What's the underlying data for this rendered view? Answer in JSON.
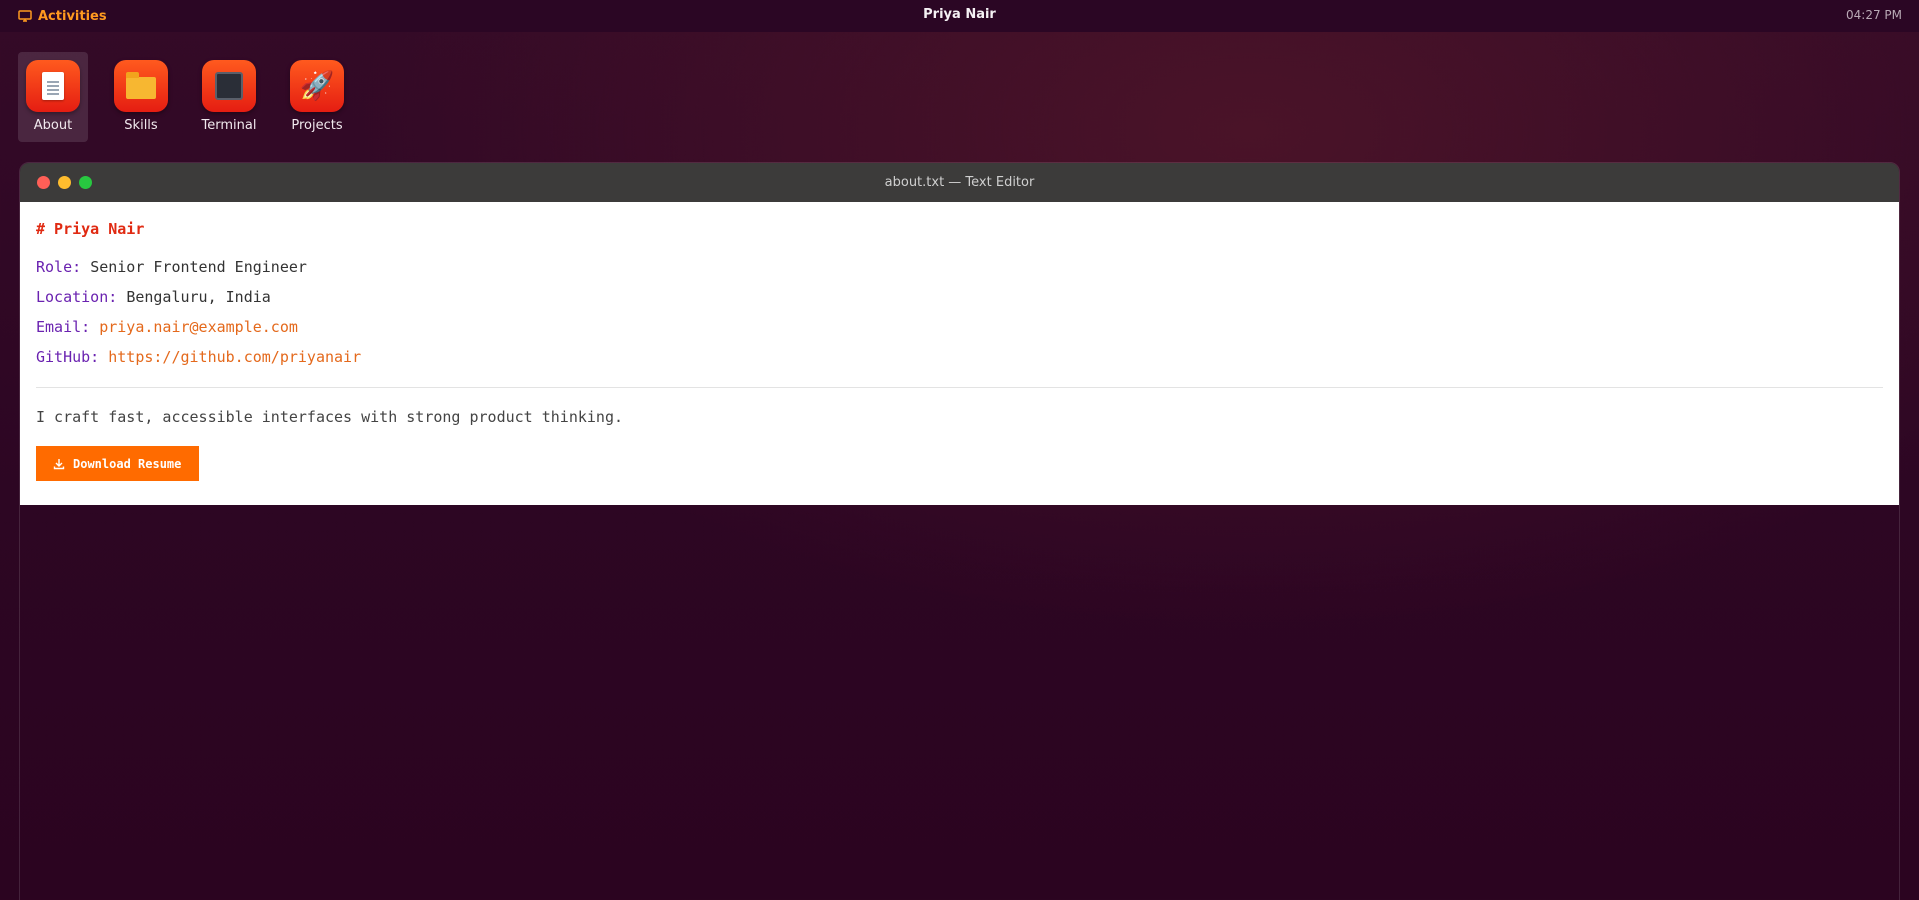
{
  "topbar": {
    "activities_label": "Activities",
    "title": "Priya Nair",
    "clock": "04:27 PM",
    "accent_color": "#ff9a1f"
  },
  "dock": {
    "items": [
      {
        "label": "About",
        "icon": "document-icon",
        "active": true
      },
      {
        "label": "Skills",
        "icon": "folder-icon",
        "active": false
      },
      {
        "label": "Terminal",
        "icon": "terminal-icon",
        "active": false
      },
      {
        "label": "Projects",
        "icon": "rocket-icon",
        "active": false
      }
    ]
  },
  "window": {
    "title": "about.txt — Text Editor",
    "heading": "# Priya Nair",
    "fields": [
      {
        "key": "Role:",
        "value": "Senior Frontend Engineer",
        "is_link": false
      },
      {
        "key": "Location:",
        "value": "Bengaluru, India",
        "is_link": false
      },
      {
        "key": "Email:",
        "value": "priya.nair@example.com",
        "is_link": true
      },
      {
        "key": "GitHub:",
        "value": "https://github.com/priyanair",
        "is_link": true
      }
    ],
    "summary": "I craft fast, accessible interfaces with strong product thinking.",
    "download_button_label": "Download Resume",
    "button_color": "#ff6b00"
  }
}
